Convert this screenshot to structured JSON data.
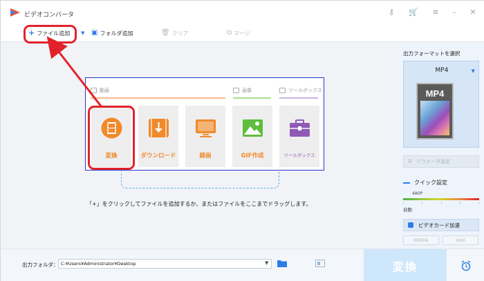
{
  "app": {
    "title": "ビデオコンバータ"
  },
  "titlebar": {
    "key_icon": "key-icon",
    "cart_icon": "cart-icon",
    "menu_icon": "menu-icon",
    "minimize_icon": "minimize-icon",
    "close_icon": "close-icon"
  },
  "toolbar": {
    "add_file": "ファイル追加",
    "add_folder": "フォルダ追加",
    "clear": "クリア",
    "merge": "マージ"
  },
  "categories": {
    "video": "動画",
    "image": "画像",
    "toolbox": "ツールボックス"
  },
  "tiles": [
    {
      "label": "変換",
      "color": "#f08a2c"
    },
    {
      "label": "ダウンロード",
      "color": "#f08a2c"
    },
    {
      "label": "録画",
      "color": "#f08a2c"
    },
    {
      "label": "GIF作成",
      "color": "#f08a2c"
    },
    {
      "label": "ツールボックス",
      "color": "#8e5bb5"
    }
  ],
  "hint": "「+」をクリックしてファイルを追加するか、またはファイルをここまでドラッグします。",
  "right_panel": {
    "title": "出力フォーマットを選択",
    "format": "MP4",
    "format_badge": "MP4",
    "param_button": "パラメータ設定",
    "quick_setting": "クイック設定",
    "resolution": "480P",
    "auto": "自動",
    "gpu_button": "ビデオカード加速",
    "vendor_nvidia": "NVIDIA",
    "vendor_intel": "Intel"
  },
  "bottom": {
    "output_label": "出力フォルダ：",
    "output_path": "C:¥Users¥Administrator¥Desktop",
    "convert": "変換"
  },
  "colors": {
    "accent": "#2b7de9",
    "highlight": "#e2222a",
    "box": "#2637c4",
    "tile_orange": "#f08a2c",
    "tile_purple": "#8e5bb5",
    "gif_green": "#5fbe3c"
  }
}
